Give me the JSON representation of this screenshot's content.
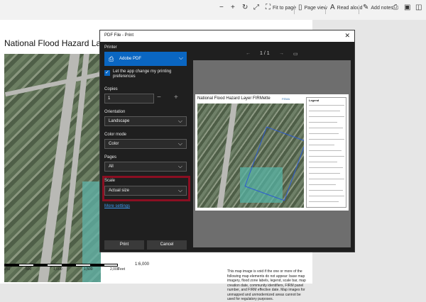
{
  "toolbar": {
    "items": [
      {
        "icon": "minus-icon",
        "glyph": "−",
        "label": ""
      },
      {
        "icon": "plus-icon",
        "glyph": "+",
        "label": ""
      },
      {
        "icon": "rotate-icon",
        "glyph": "↻",
        "label": ""
      },
      {
        "icon": "expand-icon",
        "glyph": "⤢",
        "label": ""
      },
      {
        "icon": "fit-page-icon",
        "glyph": "⛶",
        "label": "Fit to page"
      },
      {
        "icon": "page-view-icon",
        "glyph": "▯",
        "label": "Page view"
      },
      {
        "icon": "read-aloud-icon",
        "glyph": "A",
        "label": "Read aloud"
      },
      {
        "icon": "add-notes-icon",
        "glyph": "✎",
        "label": "Add notes"
      },
      {
        "icon": "print-icon",
        "glyph": "⎙",
        "label": ""
      },
      {
        "icon": "save-icon",
        "glyph": "▣",
        "label": ""
      },
      {
        "icon": "save-as-icon",
        "glyph": "◫",
        "label": ""
      }
    ]
  },
  "background_doc": {
    "title": "National Flood Hazard Lay",
    "scale_labels": [
      "250",
      "500",
      "1,000",
      "1,500",
      "2,000"
    ],
    "scale_unit": "Feet",
    "ratio": "1:6,000",
    "notes": "This map image is void if the one or more of the following map elements do not appear: base map imagery, flood zone labels, legend, scale bar, map creation date, community identifiers, FIRM panel number, and FIRM effective date. Map images for unmapped and unmodernized areas cannot be used for regulatory purposes."
  },
  "dialog": {
    "title": "PDF File - Print",
    "close_glyph": "✕",
    "printer": {
      "label": "Printer",
      "value": "Adobe PDF",
      "icon": "printer-icon"
    },
    "app_change": {
      "label": "Let the app change my printing preferences",
      "checked": true
    },
    "copies": {
      "label": "Copies",
      "value": "1",
      "minus": "−",
      "plus": "+"
    },
    "orientation": {
      "label": "Orientation",
      "value": "Landscape"
    },
    "color_mode": {
      "label": "Color mode",
      "value": "Color"
    },
    "pages": {
      "label": "Pages",
      "value": "All"
    },
    "scale": {
      "label": "Scale",
      "value": "Actual size"
    },
    "more_settings": "More settings",
    "print_button": "Print",
    "cancel_button": "Cancel",
    "chevron": "⌵",
    "highlight_color": "#8b0f22",
    "accent_color": "#0a66c2"
  },
  "preview": {
    "prev": "←",
    "page_indicator": "1 / 1",
    "next": "→",
    "fit_glyph": "▭",
    "page_title": "National Flood Hazard Layer FIRMette",
    "logo": "FEMA",
    "legend_title": "Legend"
  }
}
